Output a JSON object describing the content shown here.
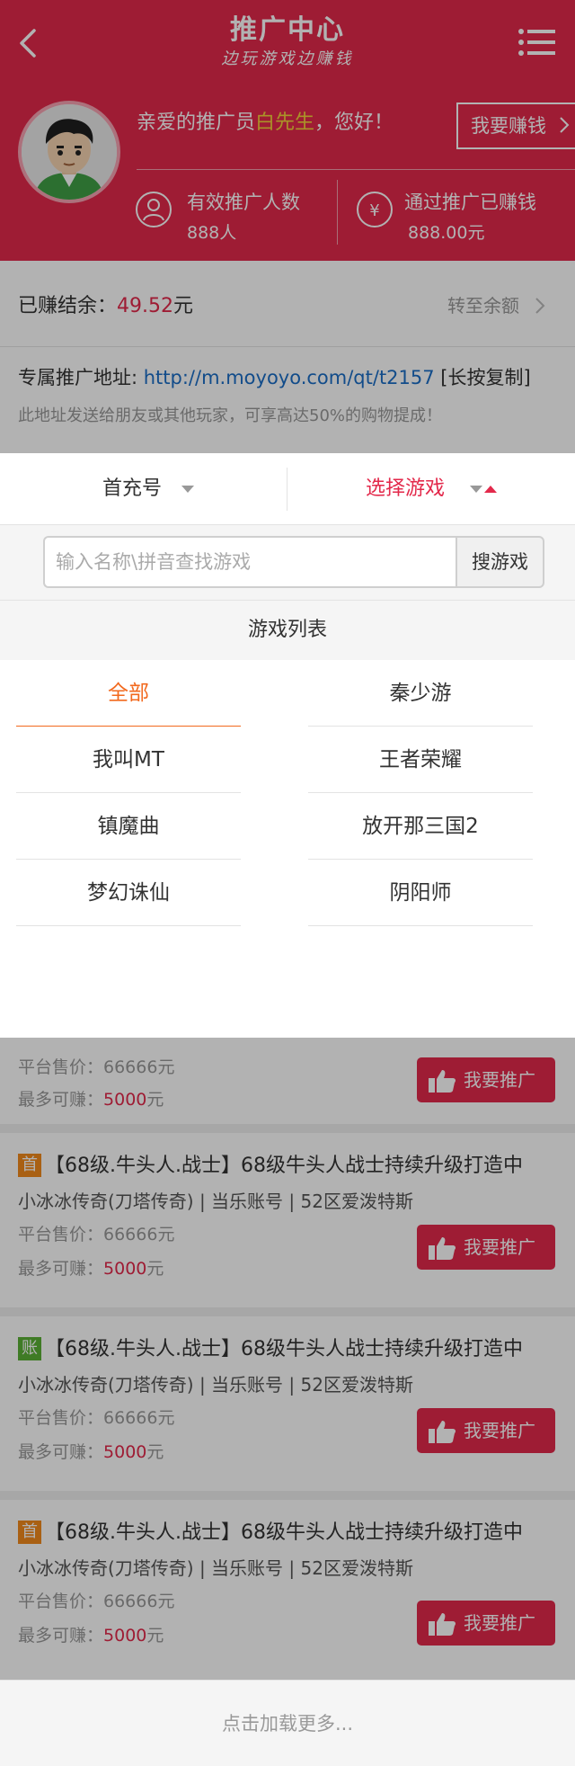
{
  "header": {
    "title": "推广中心",
    "subtitle": "边玩游戏边赚钱",
    "greeting_prefix": "亲爱的推广员",
    "user_name": "白先生",
    "greeting_suffix": "，您好！",
    "earn_button": "我要赚钱",
    "stats": [
      {
        "label": "有效推广人数",
        "value": "888人",
        "icon": "user-icon"
      },
      {
        "label": "通过推广已赚钱",
        "value": "888.00元",
        "icon": "yuan-icon"
      }
    ]
  },
  "balance": {
    "label": "已赚结余：",
    "value": "49.52",
    "unit": "元",
    "transfer_label": "转至余额"
  },
  "promo": {
    "label": "专属推广地址: ",
    "url": "http://m.moyoyo.com/qt/t2157",
    "copy_hint": " [长按复制]",
    "note": "此地址发送给朋友或其他玩家，可享高达50%的购物提成！"
  },
  "filter": {
    "left_label": "首充号",
    "right_label": "选择游戏",
    "search_placeholder": "输入名称\\拼音查找游戏",
    "search_button": "搜游戏",
    "list_title": "游戏列表",
    "games": [
      "全部",
      "秦少游",
      "我叫MT",
      "王者荣耀",
      "镇魔曲",
      "放开那三国2",
      "梦幻诛仙",
      "阴阳师"
    ],
    "selected_index": 0
  },
  "listings": [
    {
      "price": "平台售价：66666元",
      "earn_label": "最多可赚：",
      "earn_value": "5000",
      "earn_unit": "元",
      "button": "我要推广"
    },
    {
      "tag": "首",
      "tag_color": "#f28a1c",
      "title": "【68级.牛头人.战士】68级牛头人战士持续升级打造中",
      "info": "小冰冰传奇(刀塔传奇) | 当乐账号 | 52区爱泼特斯",
      "price": "平台售价：66666元",
      "earn_label": "最多可赚：",
      "earn_value": "5000",
      "earn_unit": "元",
      "button": "我要推广"
    },
    {
      "tag": "账",
      "tag_color": "#5bb036",
      "title": "【68级.牛头人.战士】68级牛头人战士持续升级打造中",
      "info": "小冰冰传奇(刀塔传奇) | 当乐账号 | 52区爱泼特斯",
      "price": "平台售价：66666元",
      "earn_label": "最多可赚：",
      "earn_value": "5000",
      "earn_unit": "元",
      "button": "我要推广"
    },
    {
      "tag": "首",
      "tag_color": "#f28a1c",
      "title": "【68级.牛头人.战士】68级牛头人战士持续升级打造中",
      "info": "小冰冰传奇(刀塔传奇) | 当乐账号 | 52区爱泼特斯",
      "price": "平台售价：66666元",
      "earn_label": "最多可赚：",
      "earn_value": "5000",
      "earn_unit": "元",
      "button": "我要推广"
    }
  ],
  "load_more": "点击加载更多...",
  "colors": {
    "brand": "#e3294b",
    "accent_orange": "#f2691e",
    "link": "#1a6dc6"
  }
}
